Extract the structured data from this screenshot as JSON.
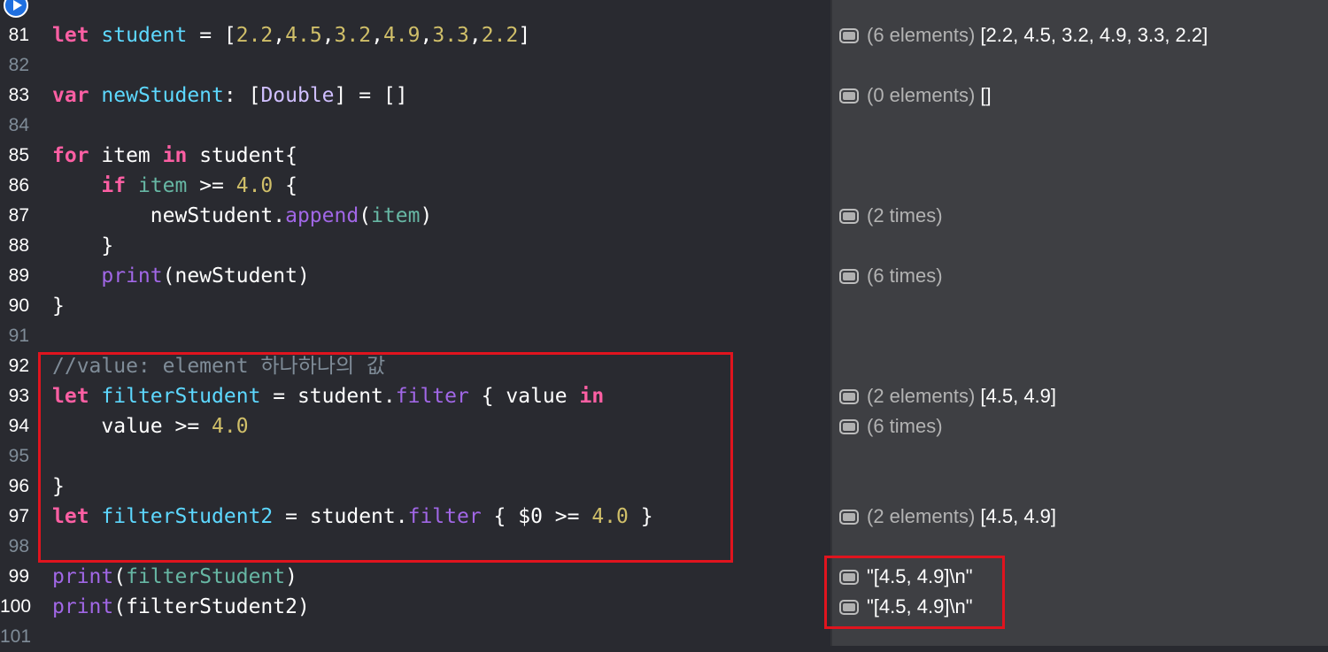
{
  "colors": {
    "keyword": "#fc5fa3",
    "type": "#d0bfff",
    "number": "#d0bf69",
    "declaration": "#5dd8ff",
    "function": "#a167e6",
    "variable": "#67b7a4",
    "comment": "#7f8c98",
    "highlight_box": "#e0141e"
  },
  "editor": {
    "run_icon": "play-icon",
    "lines": [
      {
        "n": "81",
        "segments": [
          {
            "t": "let",
            "c": "kw"
          },
          {
            "t": " "
          },
          {
            "t": "student",
            "c": "dec"
          },
          {
            "t": " = ["
          },
          {
            "t": "2.2",
            "c": "num"
          },
          {
            "t": ","
          },
          {
            "t": "4.5",
            "c": "num"
          },
          {
            "t": ","
          },
          {
            "t": "3.2",
            "c": "num"
          },
          {
            "t": ","
          },
          {
            "t": "4.9",
            "c": "num"
          },
          {
            "t": ","
          },
          {
            "t": "3.3",
            "c": "num"
          },
          {
            "t": ","
          },
          {
            "t": "2.2",
            "c": "num"
          },
          {
            "t": "]"
          }
        ]
      },
      {
        "n": "82",
        "segments": []
      },
      {
        "n": "83",
        "segments": [
          {
            "t": "var",
            "c": "kw"
          },
          {
            "t": " "
          },
          {
            "t": "newStudent",
            "c": "dec"
          },
          {
            "t": ": ["
          },
          {
            "t": "Double",
            "c": "ty"
          },
          {
            "t": "] = []"
          }
        ]
      },
      {
        "n": "84",
        "segments": []
      },
      {
        "n": "85",
        "segments": [
          {
            "t": "for",
            "c": "kw"
          },
          {
            "t": " item "
          },
          {
            "t": "in",
            "c": "kw"
          },
          {
            "t": " student{"
          }
        ]
      },
      {
        "n": "86",
        "segments": [
          {
            "t": "    "
          },
          {
            "t": "if",
            "c": "kw"
          },
          {
            "t": " "
          },
          {
            "t": "item",
            "c": "var"
          },
          {
            "t": " >= "
          },
          {
            "t": "4.0",
            "c": "num"
          },
          {
            "t": " {"
          }
        ]
      },
      {
        "n": "87",
        "segments": [
          {
            "t": "        newStudent."
          },
          {
            "t": "append",
            "c": "fn"
          },
          {
            "t": "("
          },
          {
            "t": "item",
            "c": "var"
          },
          {
            "t": ")"
          }
        ]
      },
      {
        "n": "88",
        "segments": [
          {
            "t": "    }"
          }
        ]
      },
      {
        "n": "89",
        "segments": [
          {
            "t": "    "
          },
          {
            "t": "print",
            "c": "fn"
          },
          {
            "t": "(newStudent)"
          }
        ]
      },
      {
        "n": "90",
        "segments": [
          {
            "t": "}"
          }
        ]
      },
      {
        "n": "91",
        "segments": []
      },
      {
        "n": "92",
        "segments": [
          {
            "t": "//value: element 하나하나의 값",
            "c": "cm"
          }
        ]
      },
      {
        "n": "93",
        "segments": [
          {
            "t": "let",
            "c": "kw"
          },
          {
            "t": " "
          },
          {
            "t": "filterStudent",
            "c": "dec"
          },
          {
            "t": " = student."
          },
          {
            "t": "filter",
            "c": "fn"
          },
          {
            "t": " { value "
          },
          {
            "t": "in",
            "c": "kw"
          }
        ]
      },
      {
        "n": "94",
        "segments": [
          {
            "t": "    value >= "
          },
          {
            "t": "4.0",
            "c": "num"
          }
        ]
      },
      {
        "n": "95",
        "segments": []
      },
      {
        "n": "96",
        "segments": [
          {
            "t": "}"
          }
        ]
      },
      {
        "n": "97",
        "segments": [
          {
            "t": "let",
            "c": "kw"
          },
          {
            "t": " "
          },
          {
            "t": "filterStudent2",
            "c": "dec"
          },
          {
            "t": " = student."
          },
          {
            "t": "filter",
            "c": "fn"
          },
          {
            "t": " { $0 >= "
          },
          {
            "t": "4.0",
            "c": "num"
          },
          {
            "t": " }"
          }
        ]
      },
      {
        "n": "98",
        "segments": []
      },
      {
        "n": "99",
        "segments": [
          {
            "t": "print",
            "c": "fn"
          },
          {
            "t": "("
          },
          {
            "t": "filterStudent",
            "c": "var"
          },
          {
            "t": ")"
          }
        ]
      },
      {
        "n": "100",
        "segments": [
          {
            "t": "print",
            "c": "fn"
          },
          {
            "t": "(filterStudent2)"
          }
        ]
      },
      {
        "n": "101",
        "segments": []
      }
    ]
  },
  "results": [
    {
      "line": "81",
      "meta": "(6 elements)",
      "value": " [2.2, 4.5, 3.2, 4.9, 3.3, 2.2]"
    },
    {
      "line": "83",
      "meta": "(0 elements)",
      "value": " []"
    },
    {
      "line": "87",
      "meta": "(2 times)",
      "value": ""
    },
    {
      "line": "89",
      "meta": "(6 times)",
      "value": ""
    },
    {
      "line": "93",
      "meta": "(2 elements)",
      "value": " [4.5, 4.9]"
    },
    {
      "line": "94",
      "meta": "(6 times)",
      "value": ""
    },
    {
      "line": "97",
      "meta": "(2 elements)",
      "value": " [4.5, 4.9]"
    },
    {
      "line": "99",
      "meta": "",
      "value": "\"[4.5, 4.9]\\n\""
    },
    {
      "line": "100",
      "meta": "",
      "value": "\"[4.5, 4.9]\\n\""
    }
  ]
}
